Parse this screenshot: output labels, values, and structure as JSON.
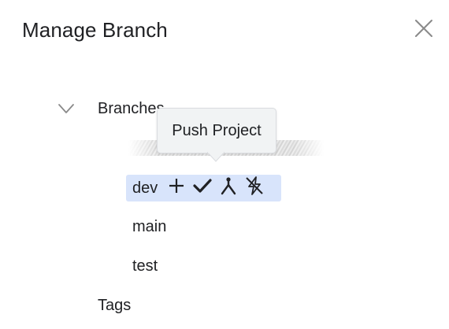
{
  "dialog": {
    "title": "Manage Branch",
    "close_icon": "close-icon"
  },
  "tree": {
    "branches_label": "Branches",
    "branches_expanded": true,
    "chevron_icon": "chevron-down-icon",
    "tooltip": "Push Project",
    "selected_branch": "dev",
    "branches": [
      {
        "name": "dev",
        "selected": true
      },
      {
        "name": "main",
        "selected": false
      },
      {
        "name": "test",
        "selected": false
      }
    ],
    "actions": [
      {
        "icon": "plus-icon",
        "tooltip": ""
      },
      {
        "icon": "check-icon",
        "tooltip": ""
      },
      {
        "icon": "merge-icon",
        "tooltip": ""
      },
      {
        "icon": "push-icon",
        "tooltip": "Push Project"
      }
    ],
    "tags_label": "Tags"
  },
  "colors": {
    "text": "#202124",
    "selected_bg": "#d8e4fb",
    "tooltip_bg": "#f1f3f4",
    "tooltip_border": "#dadce0",
    "icon_gray": "#8a8a8a"
  }
}
